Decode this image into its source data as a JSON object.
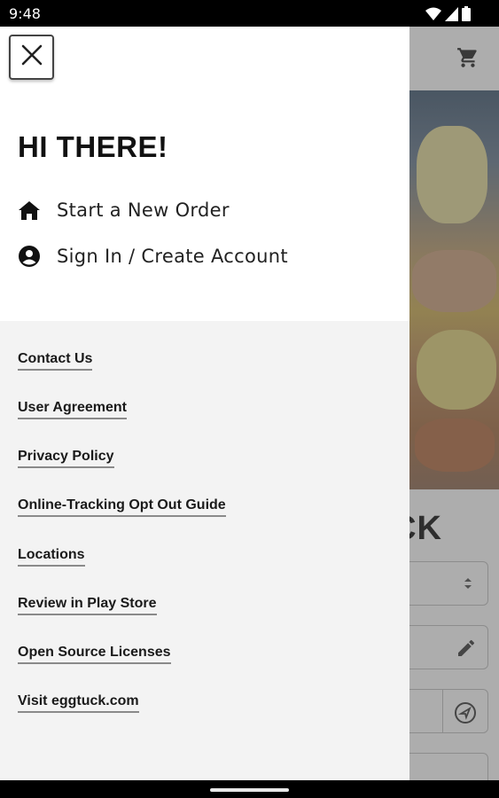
{
  "status_bar": {
    "time": "9:48",
    "icons": [
      "wifi-icon",
      "signal-icon",
      "battery-icon"
    ]
  },
  "background_app": {
    "brand_partial": "CK",
    "toolbar_icon": "cart-icon",
    "field_icons": [
      "select-arrows-icon",
      "pencil-icon",
      "navigation-icon"
    ]
  },
  "drawer": {
    "close_icon": "close-icon",
    "greeting": "HI THERE!",
    "nav_items": [
      {
        "label": "Start a New Order",
        "icon": "home-icon"
      },
      {
        "label": "Sign In / Create Account",
        "icon": "account-circle-icon"
      }
    ],
    "links": [
      "Contact Us",
      "User Agreement",
      "Privacy Policy",
      "Online-Tracking Opt Out Guide",
      "Locations",
      "Review in Play Store",
      "Open Source Licenses",
      "Visit eggtuck.com"
    ]
  },
  "colors": {
    "drawer_head_bg": "#ffffff",
    "drawer_body_bg": "#f3f3f3",
    "text_primary": "#111111",
    "link_underline": "#8a8a8a"
  }
}
